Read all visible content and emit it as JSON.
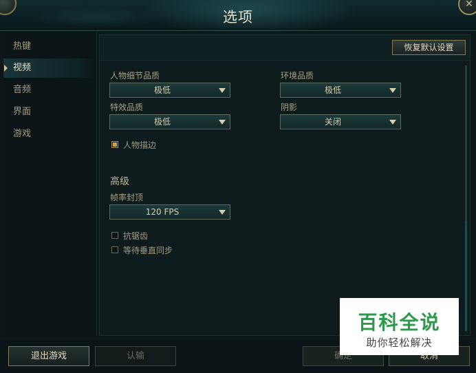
{
  "window": {
    "title": "选项"
  },
  "sidebar": {
    "items": [
      {
        "label": "热键"
      },
      {
        "label": "视频",
        "active": true
      },
      {
        "label": "音频"
      },
      {
        "label": "界面"
      },
      {
        "label": "游戏"
      }
    ]
  },
  "content": {
    "reset_label": "恢复默认设置",
    "character_quality": {
      "label": "人物细节品质",
      "value": "极低"
    },
    "environment_quality": {
      "label": "环境品质",
      "value": "极低"
    },
    "effects_quality": {
      "label": "特效品质",
      "value": "极低"
    },
    "shadows": {
      "label": "阴影",
      "value": "关闭"
    },
    "character_outline": {
      "label": "人物描边",
      "checked": true
    },
    "advanced_heading": "高级",
    "frame_rate_cap": {
      "label": "帧率封顶",
      "value": "120 FPS"
    },
    "anti_aliasing": {
      "label": "抗锯齿",
      "checked": false
    },
    "vsync": {
      "label": "等待垂直同步",
      "checked": false
    }
  },
  "footer": {
    "quit_label": "退出游戏",
    "confirm_disabled_label": "认输",
    "ok_label": "确定",
    "cancel_label": "取消"
  },
  "watermark": {
    "title": "百科全说",
    "subtitle": "助你轻松解决"
  },
  "colors": {
    "accent_gold": "#cdbe91",
    "panel_bg": "#0d1b1d",
    "watermark_green": "#2c9a4a"
  }
}
